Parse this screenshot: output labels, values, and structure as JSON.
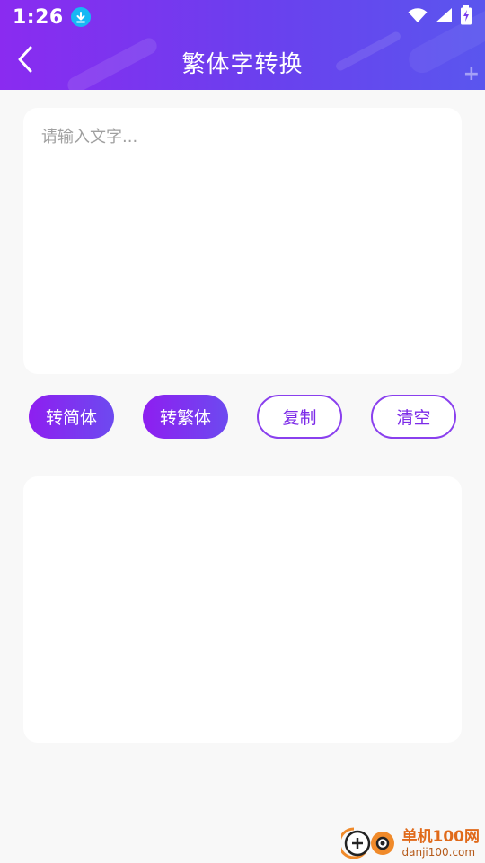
{
  "status_bar": {
    "time": "1:26",
    "download_icon": "download-icon",
    "wifi_icon": "wifi-icon",
    "signal_icon": "signal-icon",
    "battery_icon": "battery-charging-icon"
  },
  "app_bar": {
    "title": "繁体字转换",
    "back_icon": "chevron-left-icon"
  },
  "input": {
    "placeholder": "请输入文字...",
    "value": ""
  },
  "buttons": {
    "to_simplified": "转简体",
    "to_traditional": "转繁体",
    "copy": "复制",
    "clear": "清空"
  },
  "output": {
    "text": ""
  },
  "watermark": {
    "cn": "单机100网",
    "en": "danji100.com"
  },
  "colors": {
    "accent_start": "#8e1ef0",
    "accent_end": "#5a56ee",
    "outline_text": "#7d2be8",
    "background": "#f8f8f8"
  }
}
